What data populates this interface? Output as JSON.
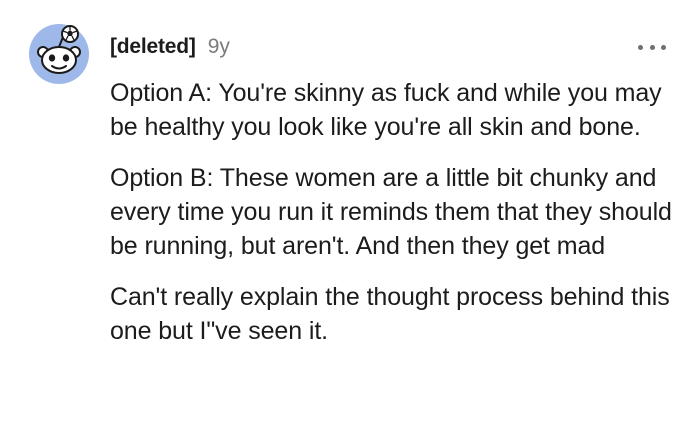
{
  "comment": {
    "author": "[deleted]",
    "age": "9y",
    "paragraphs": [
      "Option A: You're skinny as fuck and while you may be healthy you look like you're all skin and bone.",
      "Option B: These women are a little bit chunky and every time you run it reminds them that they should be running, but aren't. And then they get mad",
      "Can't really explain the thought process behind this one but I\"ve seen it."
    ]
  },
  "icons": {
    "avatar": "snoo-avatar-icon",
    "more": "more-options-icon"
  },
  "colors": {
    "avatar_bg": "#9fb8ea",
    "text": "#1c1c1c",
    "muted": "#7c7c7c"
  }
}
